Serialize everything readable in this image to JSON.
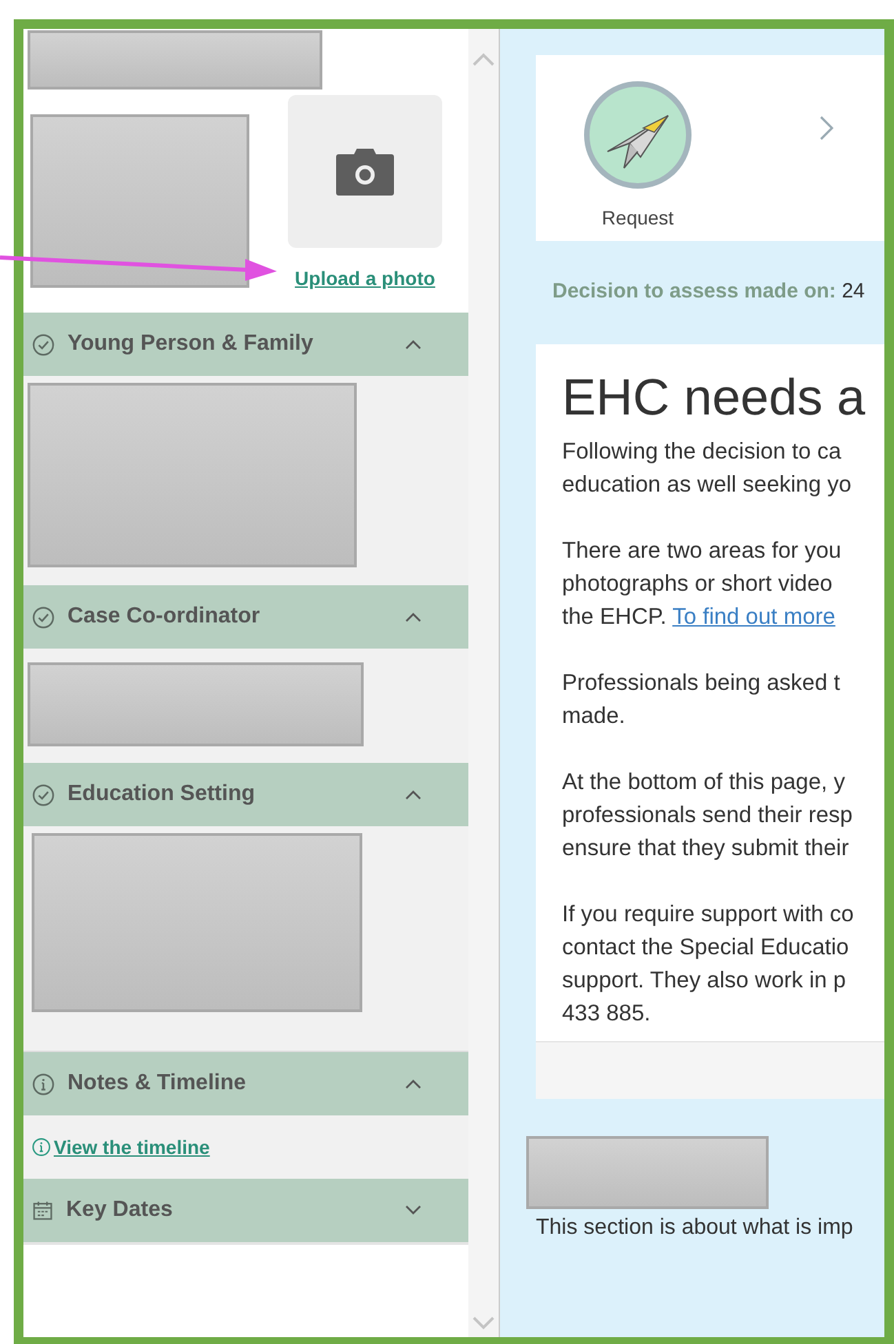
{
  "profile": {
    "upload_link": "Upload a photo"
  },
  "sections": [
    {
      "title": "Young Person & Family",
      "kind": "check",
      "expanded": true,
      "body": [
        {
          "kind": "redacted"
        }
      ]
    },
    {
      "title": "Case Co-ordinator",
      "kind": "check",
      "expanded": true,
      "body": [
        {
          "kind": "redacted"
        }
      ]
    },
    {
      "title": "Education Setting",
      "kind": "check",
      "expanded": true,
      "body": [
        {
          "kind": "redacted"
        }
      ]
    },
    {
      "title": "Notes & Timeline",
      "kind": "info",
      "expanded": true,
      "body": [
        {
          "kind": "link",
          "text": "View the timeline"
        }
      ]
    },
    {
      "title": "Key Dates",
      "kind": "calendar",
      "expanded": false
    }
  ],
  "steps": [
    {
      "label": "Request"
    }
  ],
  "decision": "**Decision to assess made on:** 24",
  "card": {
    "heading": "EHC needs a",
    "paragraphs": [
      {
        "lines": [
          "Following the decision to ca",
          "education as well seeking yo"
        ]
      },
      {
        "lines": [
          "There are two areas for you",
          "photographs or short video",
          "the EHCP. "
        ],
        "link": "To find out more"
      },
      {
        "lines": [
          "Professionals being asked t",
          "made."
        ]
      },
      {
        "lines": [
          "At the bottom of this page, y",
          "professionals send their resp",
          "ensure that they submit their"
        ]
      },
      {
        "lines": [
          "If you require support with co",
          "contact the Special Educatio",
          "support. They also work in p",
          "433 885."
        ]
      }
    ]
  },
  "section_intro": "This section is about what is imp"
}
